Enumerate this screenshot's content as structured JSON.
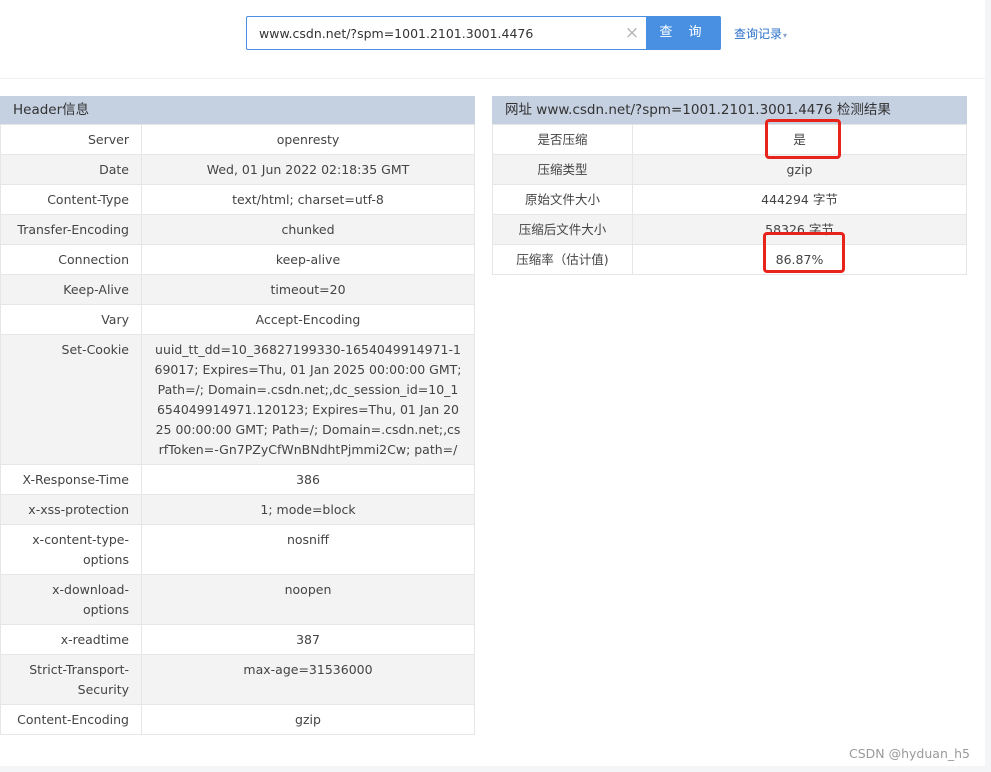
{
  "search": {
    "value": "www.csdn.net/?spm=1001.2101.3001.4476",
    "button_label": "查 询",
    "clear_glyph": "×",
    "history_label": "查询记录",
    "history_caret": "▾"
  },
  "header_panel": {
    "title": "Header信息",
    "rows": [
      {
        "key": "Server",
        "value": "openresty"
      },
      {
        "key": "Date",
        "value": "Wed, 01 Jun 2022 02:18:35 GMT"
      },
      {
        "key": "Content-Type",
        "value": "text/html; charset=utf-8"
      },
      {
        "key": "Transfer-Encoding",
        "value": "chunked"
      },
      {
        "key": "Connection",
        "value": "keep-alive"
      },
      {
        "key": "Keep-Alive",
        "value": "timeout=20"
      },
      {
        "key": "Vary",
        "value": "Accept-Encoding"
      },
      {
        "key": "Set-Cookie",
        "value": "uuid_tt_dd=10_36827199330-1654049914971-169017; Expires=Thu, 01 Jan 2025 00:00:00 GMT; Path=/; Domain=.csdn.net;,dc_session_id=10_1654049914971.120123; Expires=Thu, 01 Jan 2025 00:00:00 GMT; Path=/; Domain=.csdn.net;,csrfToken=-Gn7PZyCfWnBNdhtPjmmi2Cw; path=/"
      },
      {
        "key": "X-Response-Time",
        "value": "386"
      },
      {
        "key": "x-xss-protection",
        "value": "1; mode=block"
      },
      {
        "key": "x-content-type-options",
        "value": "nosniff"
      },
      {
        "key": "x-download-options",
        "value": "noopen"
      },
      {
        "key": "x-readtime",
        "value": "387"
      },
      {
        "key": "Strict-Transport-Security",
        "value": "max-age=31536000"
      },
      {
        "key": "Content-Encoding",
        "value": "gzip"
      }
    ]
  },
  "result_panel": {
    "title": "网址 www.csdn.net/?spm=1001.2101.3001.4476 检测结果",
    "rows": [
      {
        "key": "是否压缩",
        "value": "是"
      },
      {
        "key": "压缩类型",
        "value": "gzip"
      },
      {
        "key": "原始文件大小",
        "value": "444294 字节"
      },
      {
        "key": "压缩后文件大小",
        "value": "58326 字节"
      },
      {
        "key": "压缩率（估计值)",
        "value": "86.87%"
      }
    ]
  },
  "watermark": "CSDN @hyduan_h5",
  "colors": {
    "accent": "#4a90e2",
    "panel_header": "#c5d0e1",
    "highlight": "#e8231b"
  }
}
